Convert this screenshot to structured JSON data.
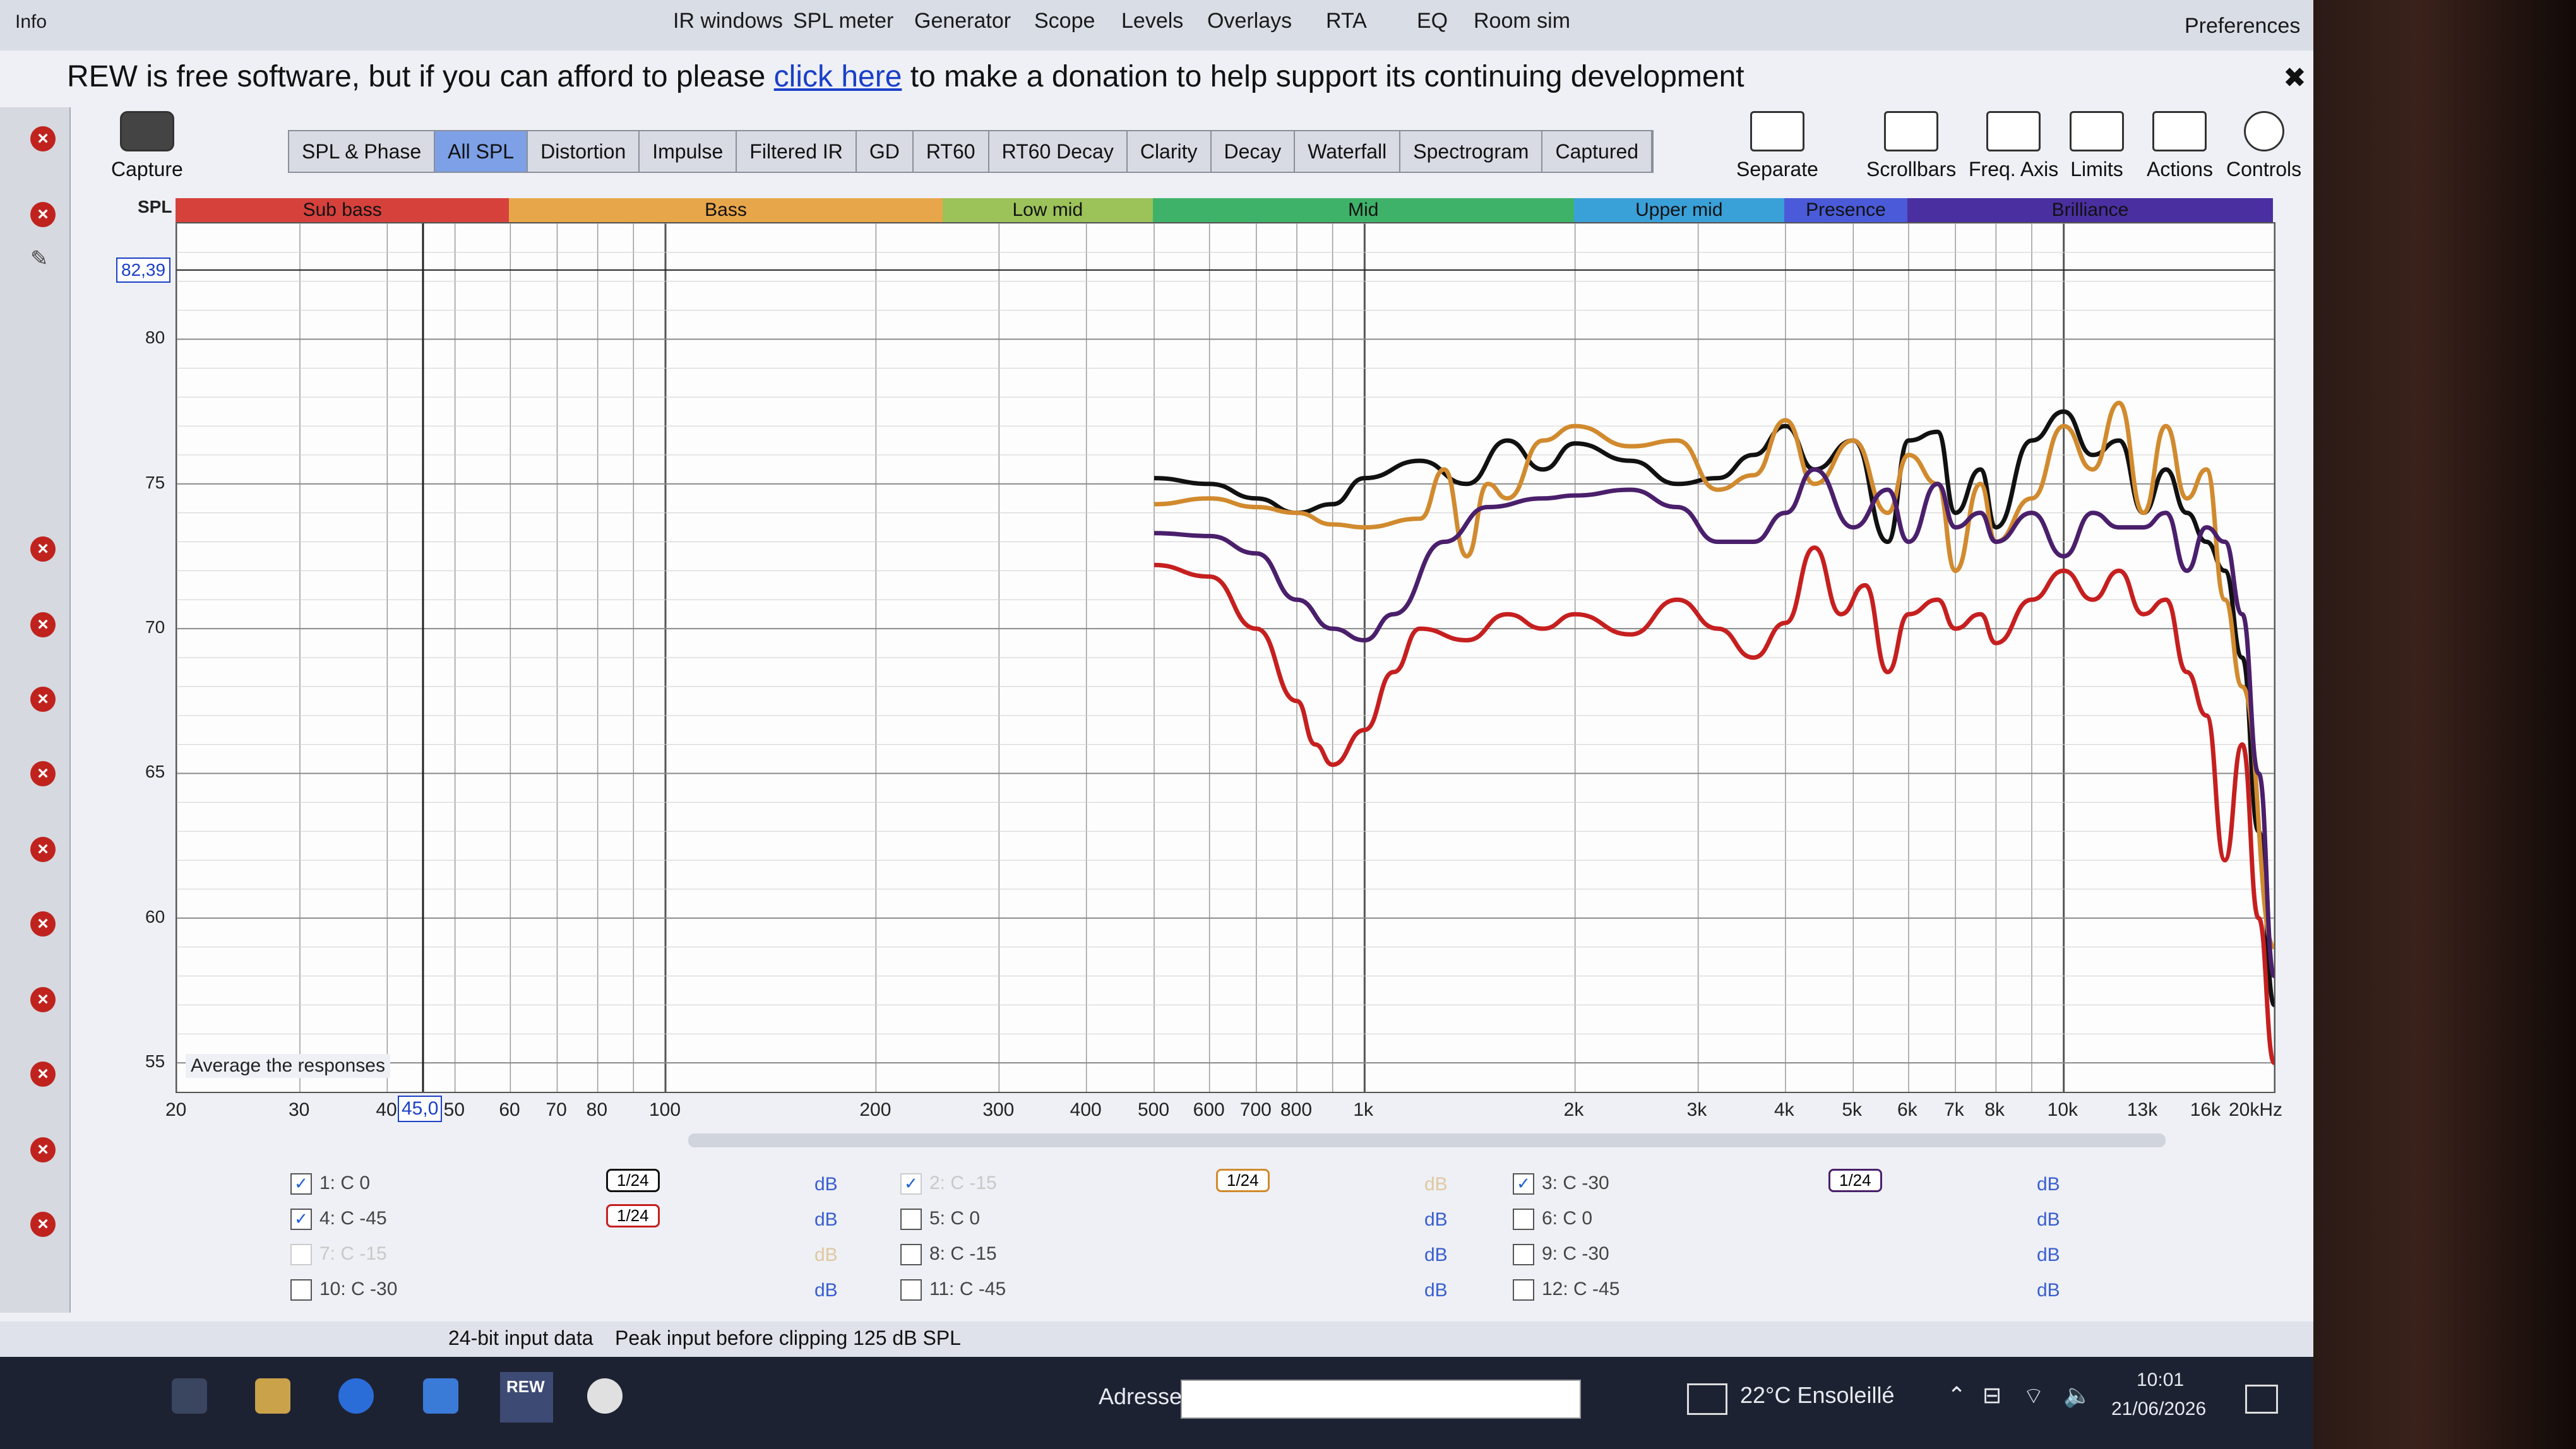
{
  "menu": {
    "info": "Info",
    "items": [
      "IR windows",
      "SPL meter",
      "Generator",
      "Scope",
      "Levels",
      "Overlays",
      "RTA",
      "EQ",
      "Room sim"
    ],
    "preferences": "Preferences"
  },
  "donation": {
    "prefix": "REW is free software, but if you can afford to please ",
    "link": "click here",
    "suffix": " to make a donation to help support its continuing development",
    "close": "✖"
  },
  "toolbar": {
    "capture": "Capture",
    "tabs": [
      "SPL & Phase",
      "All SPL",
      "Distortion",
      "Impulse",
      "Filtered IR",
      "GD",
      "RT60",
      "RT60 Decay",
      "Clarity",
      "Decay",
      "Waterfall",
      "Spectrogram",
      "Captured"
    ],
    "active_tab": "All SPL",
    "tools": [
      "Separate",
      "Scrollbars",
      "Freq. Axis",
      "Limits",
      "Actions",
      "Controls"
    ]
  },
  "bands": [
    {
      "name": "Sub bass",
      "color": "#d6413c"
    },
    {
      "name": "Bass",
      "color": "#e8a64a"
    },
    {
      "name": "Low mid",
      "color": "#9cc25a"
    },
    {
      "name": "Mid",
      "color": "#3fb26a"
    },
    {
      "name": "Upper mid",
      "color": "#3aa0d8"
    },
    {
      "name": "Presence",
      "color": "#4a5ad8"
    },
    {
      "name": "Brilliance",
      "color": "#4a2fa0"
    }
  ],
  "axis": {
    "y_label": "SPL",
    "y_ticks": [
      "80",
      "75",
      "70",
      "65",
      "60",
      "55"
    ],
    "x_ticks": [
      "20",
      "30",
      "40",
      "50",
      "60",
      "70",
      "80",
      "100",
      "200",
      "300",
      "400",
      "500",
      "600",
      "700",
      "800",
      "1k",
      "2k",
      "3k",
      "4k",
      "5k",
      "6k",
      "7k",
      "8k",
      "10k",
      "13k",
      "16k",
      "20kHz"
    ],
    "cursor_y": "82,39",
    "cursor_x": "45,0",
    "average_label": "Average the responses"
  },
  "chart_data": {
    "type": "line",
    "xscale": "log",
    "xlim": [
      20,
      20000
    ],
    "ylim": [
      54,
      84
    ],
    "ylabel": "SPL",
    "series": [
      {
        "name": "1: C 0",
        "color": "#111111",
        "x": [
          500,
          600,
          700,
          800,
          900,
          1000,
          1200,
          1400,
          1600,
          1800,
          2000,
          2400,
          2800,
          3200,
          3600,
          4000,
          4400,
          5000,
          5600,
          6000,
          6600,
          7000,
          7600,
          8000,
          9000,
          10000,
          11000,
          12000,
          13000,
          14000,
          15000,
          16000,
          17000,
          18000,
          19000,
          20000
        ],
        "y": [
          75.2,
          75.0,
          74.5,
          74.0,
          74.3,
          75.2,
          75.8,
          75.0,
          76.5,
          75.5,
          76.4,
          75.8,
          75.0,
          75.2,
          76.0,
          77.0,
          75.5,
          76.5,
          73.0,
          76.5,
          76.8,
          74.0,
          75.5,
          73.5,
          76.5,
          77.5,
          76.0,
          76.5,
          74.0,
          75.5,
          74.0,
          73.0,
          72.0,
          69.0,
          63.0,
          57.0
        ]
      },
      {
        "name": "3: C -30",
        "color": "#d18a2e",
        "x": [
          500,
          600,
          700,
          800,
          900,
          1000,
          1200,
          1300,
          1400,
          1500,
          1600,
          1800,
          2000,
          2400,
          2800,
          3200,
          3600,
          4000,
          4400,
          5000,
          5600,
          6000,
          6600,
          7000,
          7600,
          8000,
          9000,
          10000,
          11000,
          12000,
          13000,
          14000,
          15000,
          16000,
          17000,
          18000,
          20000
        ],
        "y": [
          74.3,
          74.5,
          74.2,
          74.0,
          73.6,
          73.5,
          73.8,
          75.5,
          72.5,
          75.0,
          74.5,
          76.5,
          77.0,
          76.3,
          76.5,
          74.8,
          75.3,
          77.2,
          75.0,
          76.5,
          74.0,
          76.0,
          75.0,
          72.0,
          75.0,
          73.0,
          74.5,
          77.0,
          75.5,
          77.8,
          74.0,
          77.0,
          74.5,
          75.5,
          71.0,
          68.0,
          59.0
        ]
      },
      {
        "name": "4: C -45",
        "color": "#4a1f6b",
        "x": [
          500,
          600,
          700,
          800,
          900,
          1000,
          1100,
          1300,
          1500,
          1800,
          2000,
          2400,
          2800,
          3200,
          3600,
          4000,
          4400,
          5000,
          5600,
          6000,
          6600,
          7000,
          7600,
          8000,
          9000,
          10000,
          11000,
          12000,
          13000,
          14000,
          15000,
          16000,
          17000,
          18000,
          19000,
          20000
        ],
        "y": [
          73.3,
          73.2,
          72.6,
          71.0,
          70.0,
          69.6,
          70.5,
          73.0,
          74.2,
          74.5,
          74.6,
          74.8,
          74.2,
          73.0,
          73.0,
          74.0,
          75.5,
          73.5,
          74.8,
          73.0,
          75.0,
          73.5,
          74.0,
          73.0,
          74.0,
          72.5,
          74.0,
          73.5,
          73.5,
          74.0,
          72.0,
          73.5,
          73.0,
          70.5,
          65.0,
          58.0
        ]
      },
      {
        "name": "C -15",
        "color": "#c61f1f",
        "x": [
          500,
          600,
          700,
          800,
          850,
          900,
          1000,
          1100,
          1200,
          1400,
          1600,
          1800,
          2000,
          2400,
          2800,
          3200,
          3600,
          4000,
          4400,
          4800,
          5200,
          5600,
          6000,
          6600,
          7000,
          7600,
          8000,
          9000,
          10000,
          11000,
          12000,
          13000,
          14000,
          15000,
          16000,
          17000,
          18000,
          19000,
          20000
        ],
        "y": [
          72.2,
          71.8,
          70.0,
          67.5,
          66.0,
          65.3,
          66.5,
          68.5,
          70.0,
          69.6,
          70.5,
          70.0,
          70.5,
          69.8,
          71.0,
          70.0,
          69.0,
          70.2,
          72.8,
          70.5,
          71.5,
          68.5,
          70.5,
          71.0,
          70.0,
          70.5,
          69.5,
          71.0,
          72.0,
          71.0,
          72.0,
          70.5,
          71.0,
          68.5,
          67.0,
          62.0,
          66.0,
          60.0,
          55.0
        ]
      }
    ]
  },
  "legend": {
    "rows": [
      [
        {
          "label": "1: C 0",
          "checked": true,
          "active": true
        },
        {
          "label": "2: C -15",
          "checked": true,
          "active": false
        },
        {
          "label": "3: C -30",
          "checked": true,
          "active": true
        }
      ],
      [
        {
          "label": "4: C -45",
          "checked": true,
          "active": true
        },
        {
          "label": "5: C 0",
          "checked": false,
          "active": true
        },
        {
          "label": "6: C 0",
          "checked": false,
          "active": true
        }
      ],
      [
        {
          "label": "7: C -15",
          "checked": false,
          "active": false
        },
        {
          "label": "8: C -15",
          "checked": false,
          "active": true
        },
        {
          "label": "9: C -30",
          "checked": false,
          "active": true
        }
      ],
      [
        {
          "label": "10: C -30",
          "checked": false,
          "active": true
        },
        {
          "label": "11: C -45",
          "checked": false,
          "active": true
        },
        {
          "label": "12: C -45",
          "checked": false,
          "active": true
        }
      ]
    ],
    "db": "dB",
    "smoothing": "1/24"
  },
  "status": {
    "input": "24-bit input data",
    "peak": "Peak input before clipping 125 dB SPL"
  },
  "taskbar": {
    "address_label": "Adresse",
    "weather": "22°C  Ensoleillé",
    "time": "10:01",
    "date": "21/06/2026",
    "rew_label": "REW"
  }
}
